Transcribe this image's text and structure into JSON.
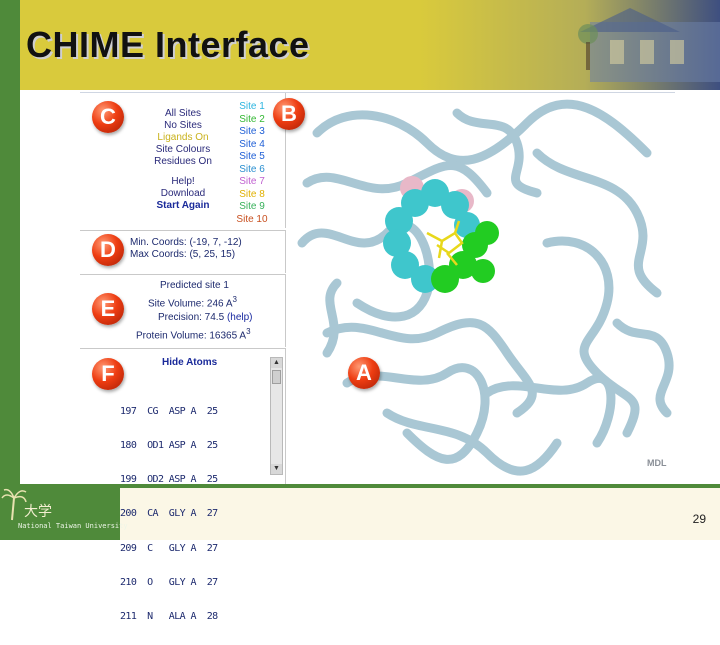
{
  "slide": {
    "title": "CHIME Interface",
    "page_number": "29",
    "university": "National Taiwan University"
  },
  "badges": {
    "c": "C",
    "b": "B",
    "d": "D",
    "e": "E",
    "f": "F",
    "a": "A"
  },
  "menu": {
    "all_sites": "All Sites",
    "no_sites": "No Sites",
    "ligands_on": "Ligands On",
    "site_colours": "Site Colours",
    "residues_on": "Residues On",
    "help": "Help!",
    "download": "Download",
    "start_again": "Start Again"
  },
  "sites": [
    {
      "label": "Site 1",
      "color": "#2bb5e0"
    },
    {
      "label": "Site 2",
      "color": "#33b833"
    },
    {
      "label": "Site 3",
      "color": "#1f5fd6"
    },
    {
      "label": "Site 4",
      "color": "#1f5fd6"
    },
    {
      "label": "Site 5",
      "color": "#1f5fd6"
    },
    {
      "label": "Site 6",
      "color": "#2a8fd0"
    },
    {
      "label": "Site 7",
      "color": "#c060d0"
    },
    {
      "label": "Site 8",
      "color": "#e0b000"
    },
    {
      "label": "Site 9",
      "color": "#37b05a"
    },
    {
      "label": "Site 10",
      "color": "#c85020"
    }
  ],
  "coords": {
    "min": "Min. Coords: (-19, 7, -12)",
    "max": "Max Coords: (5, 25, 15)"
  },
  "prediction": {
    "title": "Predicted site 1",
    "site_volume_label": "Site Volume: 246 A",
    "cube": "3",
    "precision_label": "Precision: 74.5",
    "help_link": "(help)",
    "protein_volume_label": "Protein Volume: 16365 A"
  },
  "atoms": {
    "hide_label": "Hide Atoms",
    "rows": [
      "197  CG  ASP A  25",
      "180  OD1 ASP A  25",
      "199  OD2 ASP A  25",
      "200  CA  GLY A  27",
      "209  C   GLY A  27",
      "210  O   GLY A  27",
      "211  N   ALA A  28"
    ]
  },
  "viewer": {
    "watermark": "MDL"
  },
  "colors": {
    "header": "#d9ca3c",
    "green_bar": "#4f8a3a",
    "badge": "#ee3d12",
    "protein_tube": "#9ec0cf",
    "site_spheres": "#3fc6cc",
    "site_green": "#22cc22",
    "ligand": "#e8d81a"
  }
}
